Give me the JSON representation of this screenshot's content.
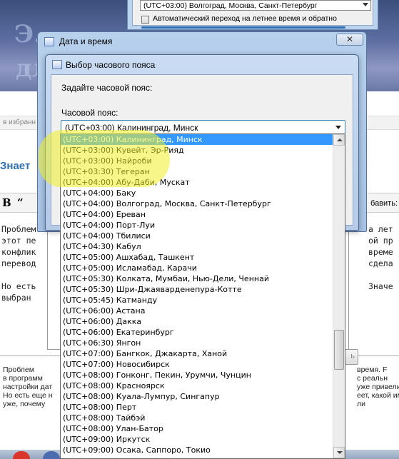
{
  "background": {
    "banner_text_1": "Э...",
    "banner_text_2": "дл",
    "favorites_text": "в избранн",
    "heading_text": "Знает",
    "toolbar_b": "B",
    "toolbar_quote": "“",
    "toolbar_add": "бавить:",
    "left_lines": [
      "Проблем",
      "этот пе",
      "конфлик",
      "перевод",
      "",
      "Но есть",
      "выбран"
    ],
    "right_lines": [
      "а лет",
      "ой пр",
      "време",
      "сдела",
      "",
      "Значе",
      ""
    ],
    "bottom_left_lines": [
      "Проблем",
      "в программ",
      "настройки дат",
      "Но есть еще н",
      "уже, почему"
    ],
    "bottom_right_lines": [
      "время. F",
      "с реальн",
      "уже привели",
      "еет, какой име",
      "ли"
    ],
    "apply_button": "ь"
  },
  "settings_window": {
    "timezone_value": "(UTC+03:00) Волгоград, Москва, Санкт-Петербург",
    "dst_checkbox_label": "Автоматический переход на летнее время и обратно"
  },
  "date_time_dialog": {
    "title": "Дата и время",
    "close_symbol": "✕"
  },
  "timezone_dialog": {
    "title": "Выбор часового пояса",
    "prompt": "Задайте часовой пояс:",
    "field_label": "Часовой пояс:",
    "selected_value": "(UTC+03:00) Калининград, Минск"
  },
  "timezone_list": {
    "selected_index": 0,
    "items": [
      "(UTC+03:00) Калининград, Минск",
      "(UTC+03:00) Кувейт, Эр-Рияд",
      "(UTC+03:00) Найроби",
      "(UTC+03:30) Тегеран",
      "(UTC+04:00) Абу-Даби, Мускат",
      "(UTC+04:00) Баку",
      "(UTC+04:00) Волгоград, Москва, Санкт-Петербург",
      "(UTC+04:00) Ереван",
      "(UTC+04:00) Порт-Луи",
      "(UTC+04:00) Тбилиси",
      "(UTC+04:30) Кабул",
      "(UTC+05:00) Ашхабад, Ташкент",
      "(UTC+05:00) Исламабад, Карачи",
      "(UTC+05:30) Колката, Мумбаи, Нью-Дели, Ченнай",
      "(UTC+05:30) Шри-Джаяварденепура-Котте",
      "(UTC+05:45) Катманду",
      "(UTC+06:00) Астана",
      "(UTC+06:00) Дакка",
      "(UTC+06:00) Екатеринбург",
      "(UTC+06:30) Янгон",
      "(UTC+07:00) Бангкок, Джакарта, Ханой",
      "(UTC+07:00) Новосибирск",
      "(UTC+08:00) Гонконг, Пекин, Урумчи, Чунцин",
      "(UTC+08:00) Красноярск",
      "(UTC+08:00) Куала-Лумпур, Сингапур",
      "(UTC+08:00) Перт",
      "(UTC+08:00) Тайбэй",
      "(UTC+08:00) Улан-Батор",
      "(UTC+09:00) Иркутск",
      "(UTC+09:00) Осака, Саппоро, Токио"
    ]
  },
  "colors": {
    "selection": "#3399ff",
    "marker": "#f0f028",
    "dialog_frame": "#b6cbe8"
  }
}
